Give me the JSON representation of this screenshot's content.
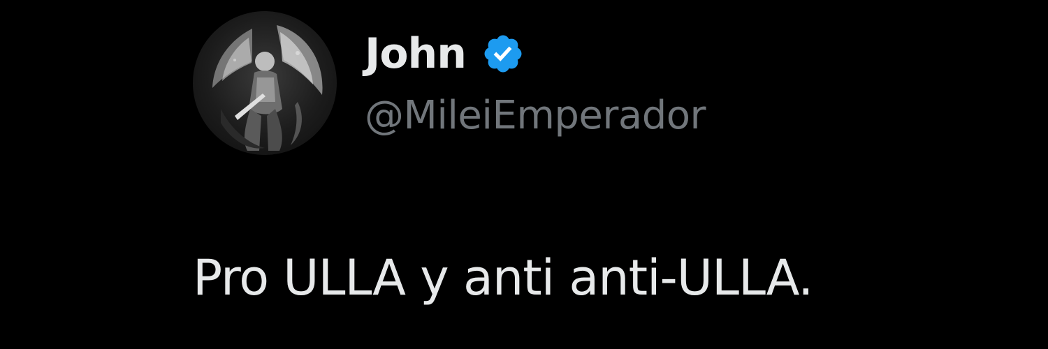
{
  "tweet": {
    "author": {
      "display_name": "John",
      "handle": "@MileiEmperador",
      "verified": true,
      "avatar_icon": "angel-warrior-avatar"
    },
    "text": "Pro ULLA y anti anti-ULLA."
  },
  "colors": {
    "background": "#000000",
    "name": "#e7e9ea",
    "handle": "#71767b",
    "verified_badge": "#1d9bf0",
    "text": "#e7e9ea"
  }
}
